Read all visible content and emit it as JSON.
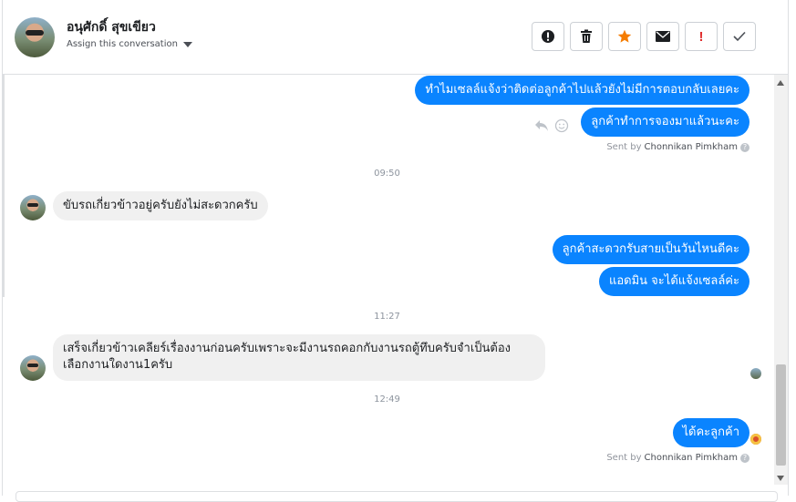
{
  "header": {
    "contact_name": "อนุศักดิ์ สุขเขียว",
    "assign_label": "Assign this conversation",
    "toolbar": [
      "info-icon",
      "trash-icon",
      "star-icon",
      "mail-icon",
      "exclamation-icon",
      "check-icon"
    ],
    "toolbar_bang": "!"
  },
  "messages": {
    "m1": "ทำไมเซลล์แจ้งว่าติดต่อลูกค้าไปแล้วยังไม่มีการตอบกลับเลยคะ",
    "m2": "ลูกค้าทำการจองมาแล้วนะคะ",
    "sent_by_prefix": "Sent by",
    "sent_by_name": "Chonnikan Pimkham",
    "time1": "09:50",
    "m3": "ขับรถเกี่ยวข้าวอยู่ครับยังไม่สะดวกครับ",
    "m4": "ลูกค้าสะดวกรับสายเป็นวันไหนดีคะ",
    "m5": "แอดมิน จะได้แจ้งเซลล์ค่ะ",
    "time2": "11:27",
    "m6_line1": "เสร็จเกี่ยวข้าวเคลียร์เรื่องงานก่อนครับเพราะจะมีงานรถคอกกับงานรถตู้ทึบครับจำเป็นต้อง",
    "m6_line2": "เลือกงานใดงาน1ครับ",
    "time3": "12:49",
    "m7": "ได้คะลูกค้า",
    "sent_by2_prefix": "Sent by",
    "sent_by2_name": "Chonnikan Pimkham"
  },
  "colors": {
    "outgoing": "#0a84ff",
    "incoming": "#f0f0f0",
    "star": "#f57c00",
    "alert": "#e02d2d"
  }
}
